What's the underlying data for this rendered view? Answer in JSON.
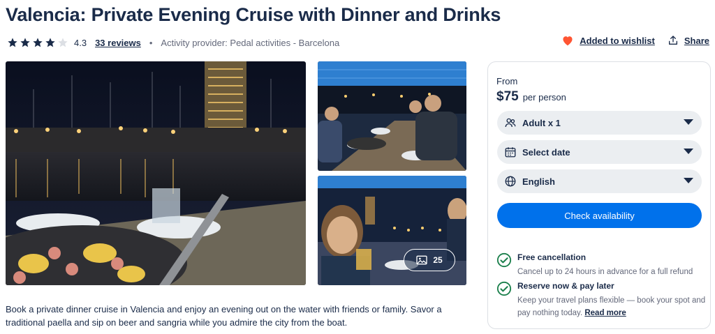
{
  "title": "Valencia: Private Evening Cruise with Dinner and Drinks",
  "meta": {
    "rating": "4.3",
    "rating_value": 4.3,
    "stars_max": 5,
    "reviews": "33 reviews",
    "separator": "•",
    "provider": "Activity provider: Pedal activities - Barcelona"
  },
  "actions": {
    "wishlist": "Added to wishlist",
    "share": "Share",
    "wishlist_icon": "heart-filled-icon",
    "share_icon": "share-icon",
    "heart_color": "#ff5533"
  },
  "gallery": {
    "photo_count": "25",
    "count_icon": "image-icon"
  },
  "description": "Book a private dinner cruise in Valencia and enjoy an evening out on the water with friends or family. Savor a traditional paella and sip on beer and sangria while you admire the city from the boat.",
  "booking": {
    "from": "From",
    "price": "$75",
    "per": "per person",
    "participants": "Adult x 1",
    "date": "Select date",
    "language": "English",
    "cta": "Check availability",
    "cta_color": "#0071eb"
  },
  "features": [
    {
      "title": "Free cancellation",
      "text": "Cancel up to 24 hours in advance for a full refund"
    },
    {
      "title": "Reserve now & pay later",
      "text": "Keep your travel plans flexible — book your spot and pay nothing today.",
      "link": "Read more"
    }
  ],
  "colors": {
    "text": "#1a2b49",
    "muted": "#63687a",
    "accent": "#0071eb",
    "success": "#1a7f4b"
  }
}
